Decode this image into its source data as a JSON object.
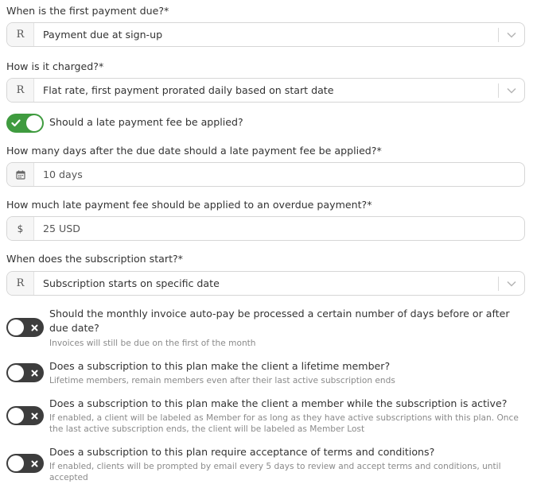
{
  "first_payment": {
    "label": "When is the first payment due?*",
    "prefix": "R",
    "value": "Payment due at sign-up"
  },
  "charged": {
    "label": "How is it charged?*",
    "prefix": "R",
    "value": "Flat rate, first payment prorated daily based on start date"
  },
  "late_fee_toggle": {
    "label": "Should a late payment fee be applied?",
    "state": "on"
  },
  "late_days": {
    "label": "How many days after the due date should a late payment fee be applied?*",
    "icon": "calendar-icon",
    "value": "10 days"
  },
  "late_amount": {
    "label": "How much late payment fee should be applied to an overdue payment?*",
    "prefix": "$",
    "value": "25 USD"
  },
  "sub_start": {
    "label": "When does the subscription start?*",
    "prefix": "R",
    "value": "Subscription starts on specific date"
  },
  "options": [
    {
      "question": "Should the monthly invoice auto-pay be processed a certain number of days before or after due date?",
      "hint": "Invoices will still be due on the first of the month",
      "state": "off"
    },
    {
      "question": "Does a subscription to this plan make the client a lifetime member?",
      "hint": "Lifetime members, remain members even after their last active subscription ends",
      "state": "off"
    },
    {
      "question": "Does a subscription to this plan make the client a member while the subscription is active?",
      "hint": "If enabled, a client will be labeled as Member for as long as they have active subscriptions with this plan. Once the last active subscription ends, the client will be labeled as Member Lost",
      "state": "off"
    },
    {
      "question": "Does a subscription to this plan require acceptance of terms and conditions?",
      "hint": "If enabled, clients will be prompted by email every 5 days to review and accept terms and conditions, until accepted",
      "state": "off"
    }
  ],
  "colors": {
    "toggle_on": "#3f9b3f",
    "toggle_off": "#3d3d3d",
    "border": "#d6d6d6"
  }
}
